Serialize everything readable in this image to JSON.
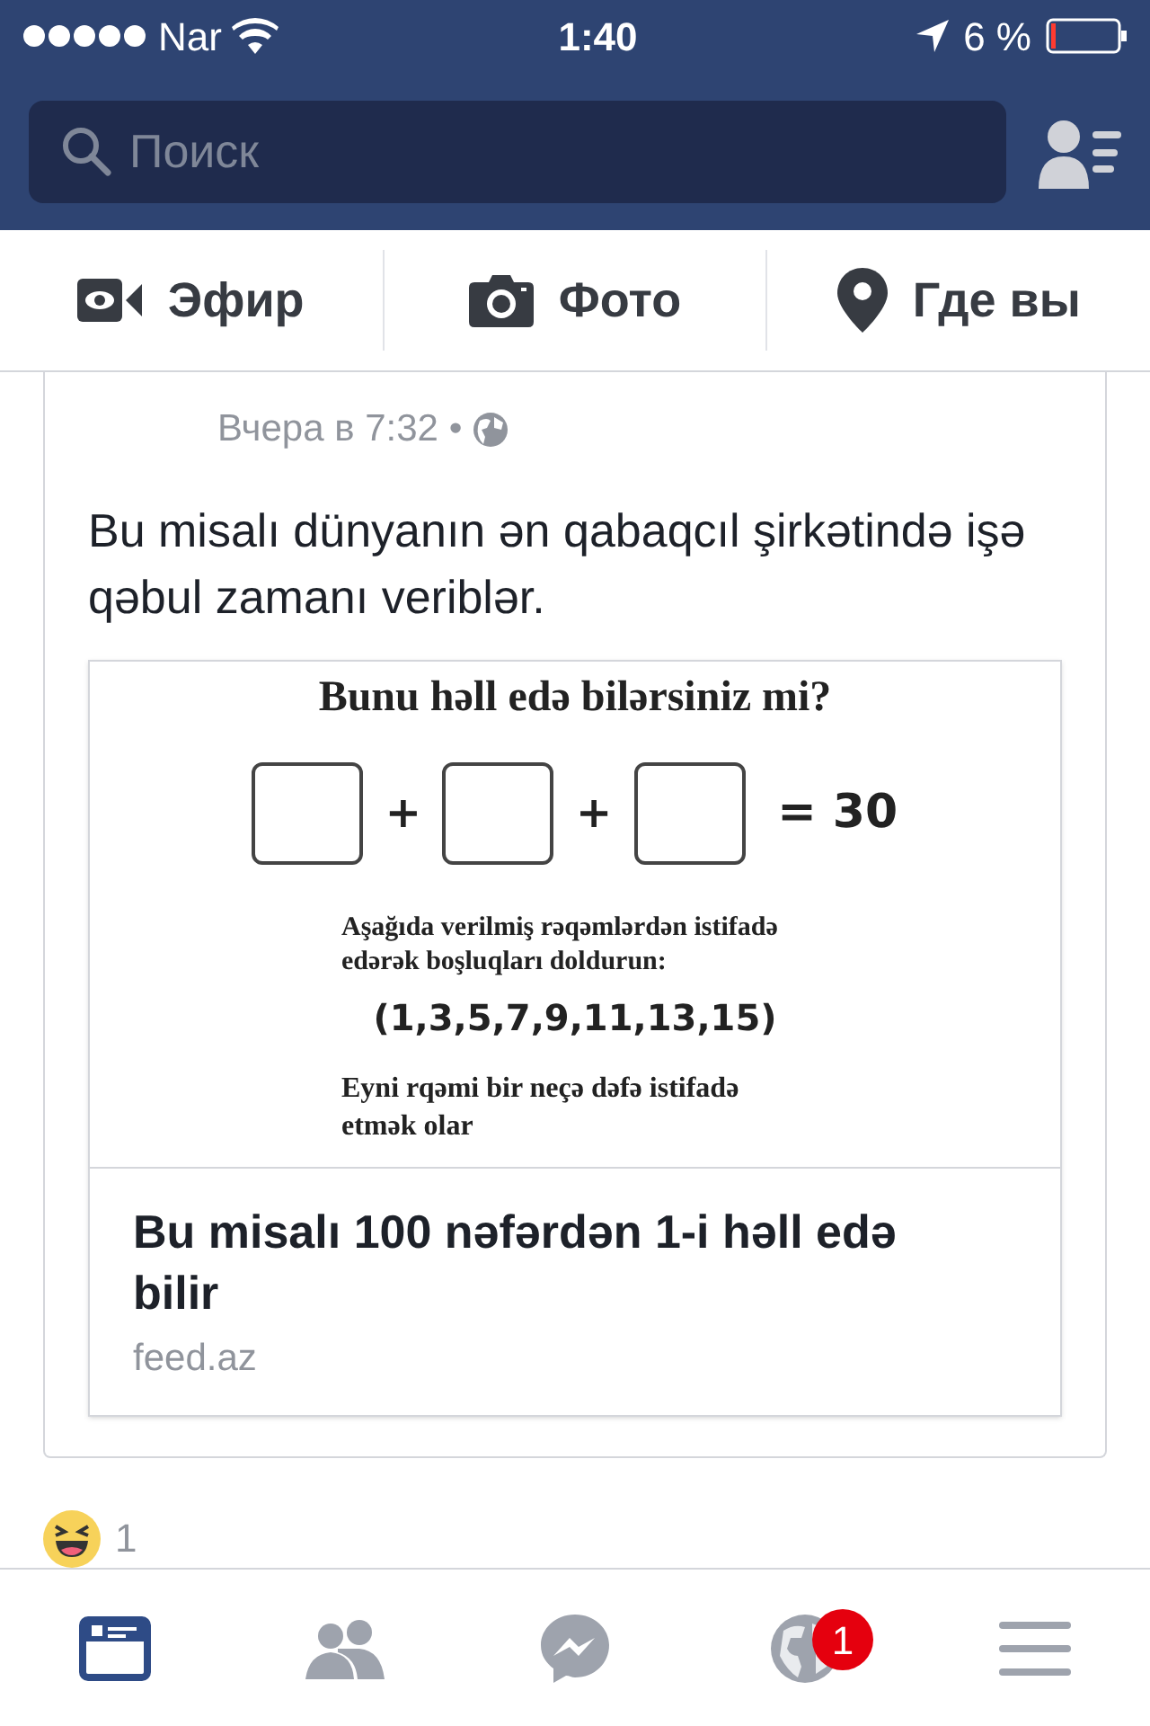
{
  "status_bar": {
    "carrier": "Nar",
    "time": "1:40",
    "battery": "6 %"
  },
  "search": {
    "placeholder": "Поиск"
  },
  "composer": [
    {
      "kind": "live",
      "label": "Эфир"
    },
    {
      "kind": "photo",
      "label": "Фото"
    },
    {
      "kind": "place",
      "label": "Где вы"
    }
  ],
  "post": {
    "time": "Вчера в 7:32 •",
    "text": "Bu misalı dünyanın ən qabaqcıl şirkətində işə qəbul zamanı veriblər.",
    "image": {
      "heading": "Bunu həll edə bilərsiniz mi?",
      "plus": [
        "+",
        "+"
      ],
      "result": "= 30",
      "instruction": "Aşağıda verilmiş rəqəmlərdən istifadə edərək boşluqları doldurun:",
      "numbers": "(1,3,5,7,9,11,13,15)",
      "note": "Eyni rqəmi bir neçə dəfə istifadə etmək olar"
    },
    "link_title": "Bu misalı 100 nəfərdən 1-i həll edə bilir",
    "link_domain": "feed.az"
  },
  "reactions": {
    "count": "1"
  },
  "tab_bar": [
    {
      "kind": "feed",
      "selected": true
    },
    {
      "kind": "friends",
      "selected": false
    },
    {
      "kind": "messenger",
      "selected": false
    },
    {
      "kind": "notifications",
      "selected": false,
      "badge": "1"
    },
    {
      "kind": "menu",
      "selected": false
    }
  ]
}
